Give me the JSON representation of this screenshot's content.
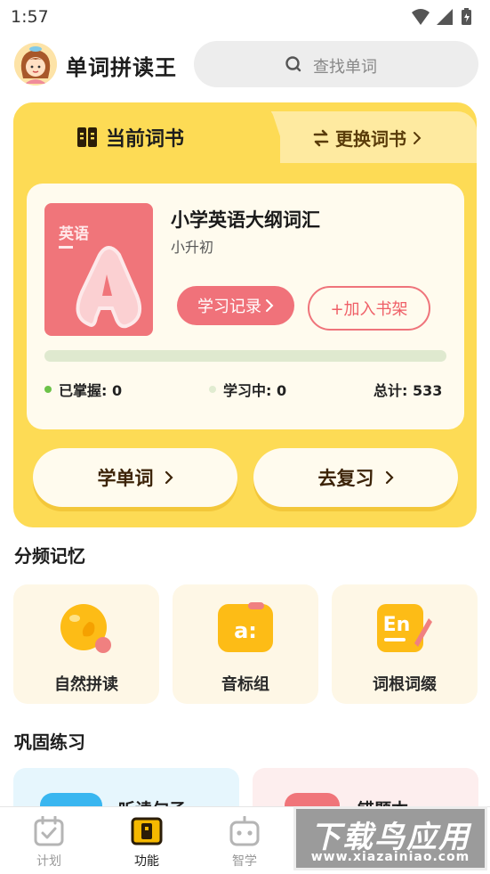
{
  "status_bar": {
    "time": "1:57"
  },
  "header": {
    "app_title": "单词拼读王",
    "search_placeholder": "查找单词"
  },
  "book_panel": {
    "current_tab": "当前词书",
    "switch_tab": "更换词书",
    "book": {
      "cover_tag": "英语",
      "name": "小学英语大纲词汇",
      "level": "小升初",
      "record_button": "学习记录",
      "add_shelf_button": "+加入书架",
      "progress_fraction": 0,
      "stats": {
        "mastered": "已掌握: 0",
        "learning": "学习中: 0",
        "total": "总计: 533"
      }
    },
    "learn_button": "学单词",
    "review_button": "去复习"
  },
  "sections": {
    "frequency_memory": "分频记忆",
    "features": [
      {
        "label": "自然拼读",
        "icon": "phonics-icon"
      },
      {
        "label": "音标组",
        "icon": "phonetic-icon"
      },
      {
        "label": "词根词缀",
        "icon": "word-root-icon"
      }
    ],
    "consolidation": "巩固练习",
    "practice_cards": [
      {
        "label": "听读句子",
        "icon": "listen-icon"
      },
      {
        "label": "错题本",
        "icon": "mistakes-icon"
      }
    ]
  },
  "tabbar": {
    "tabs": [
      {
        "label": "计划",
        "active": false
      },
      {
        "label": "功能",
        "active": true
      },
      {
        "label": "智学",
        "active": false
      }
    ]
  },
  "watermark": {
    "main": "下载鸟应用",
    "sub": "www.xiazainiao.com"
  },
  "colors": {
    "panel_yellow": "#fddb55",
    "accent_red": "#f0727a",
    "progress_green": "#7ccf57"
  }
}
